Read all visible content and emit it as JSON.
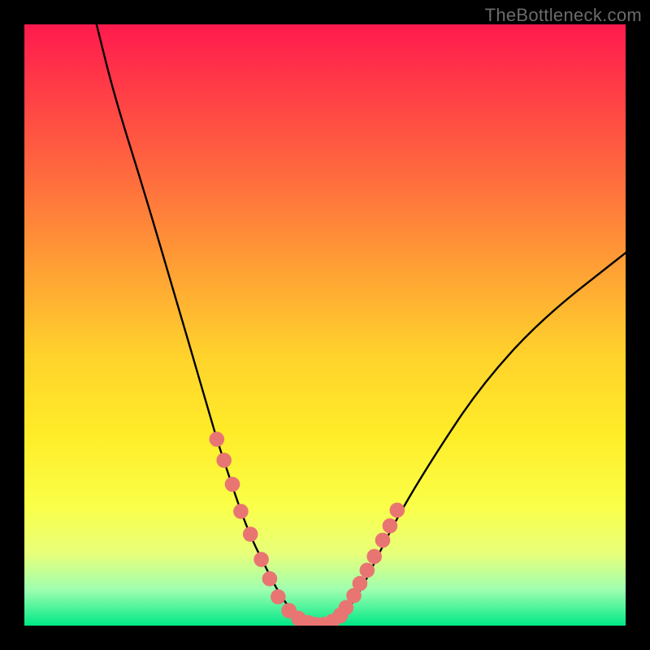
{
  "watermark": {
    "text": "TheBottleneck.com"
  },
  "chart_data": {
    "type": "line",
    "title": "",
    "xlabel": "",
    "ylabel": "",
    "xlim": [
      0,
      100
    ],
    "ylim": [
      0,
      100
    ],
    "grid": false,
    "legend": false,
    "series": [
      {
        "name": "bottleneck-curve",
        "x": [
          12,
          15,
          20,
          25,
          30,
          32,
          34,
          36,
          38,
          40,
          42,
          44,
          46,
          48,
          50,
          52,
          54,
          56,
          58,
          62,
          68,
          76,
          86,
          100
        ],
        "y": [
          100,
          88,
          72,
          55,
          38,
          31,
          25,
          19,
          14,
          10,
          6,
          3,
          1,
          0,
          0,
          1,
          3,
          6,
          10,
          18,
          28,
          40,
          51,
          62
        ]
      }
    ],
    "markers": [
      {
        "name": "left-threshold-points",
        "x": [
          32.0,
          33.2,
          34.6,
          36.0,
          37.6,
          39.4,
          40.8,
          42.2,
          44.0,
          45.6
        ],
        "y": [
          31.0,
          27.5,
          23.5,
          19.0,
          15.2,
          11.0,
          7.8,
          4.8,
          2.5,
          1.2
        ]
      },
      {
        "name": "right-threshold-points",
        "x": [
          52.5,
          53.5,
          54.8,
          55.8,
          57.0,
          58.2,
          59.6,
          60.8,
          62.0
        ],
        "y": [
          1.6,
          3.0,
          5.0,
          7.0,
          9.2,
          11.5,
          14.2,
          16.6,
          19.2
        ]
      },
      {
        "name": "valley-points",
        "x": [
          44.0,
          45.6,
          47.2,
          48.4,
          49.8,
          51.2,
          52.6
        ],
        "y": [
          2.5,
          1.2,
          0.5,
          0.2,
          0.2,
          0.7,
          1.8
        ]
      }
    ],
    "marker_style": {
      "color": "#e97572",
      "radius_pct": 1.25
    },
    "gradient_stops": [
      {
        "pct": 0,
        "color": "#ff1a4d"
      },
      {
        "pct": 25,
        "color": "#ff6a3e"
      },
      {
        "pct": 55,
        "color": "#ffd22c"
      },
      {
        "pct": 80,
        "color": "#faff48"
      },
      {
        "pct": 94,
        "color": "#9fffb0"
      },
      {
        "pct": 100,
        "color": "#00e887"
      }
    ]
  }
}
